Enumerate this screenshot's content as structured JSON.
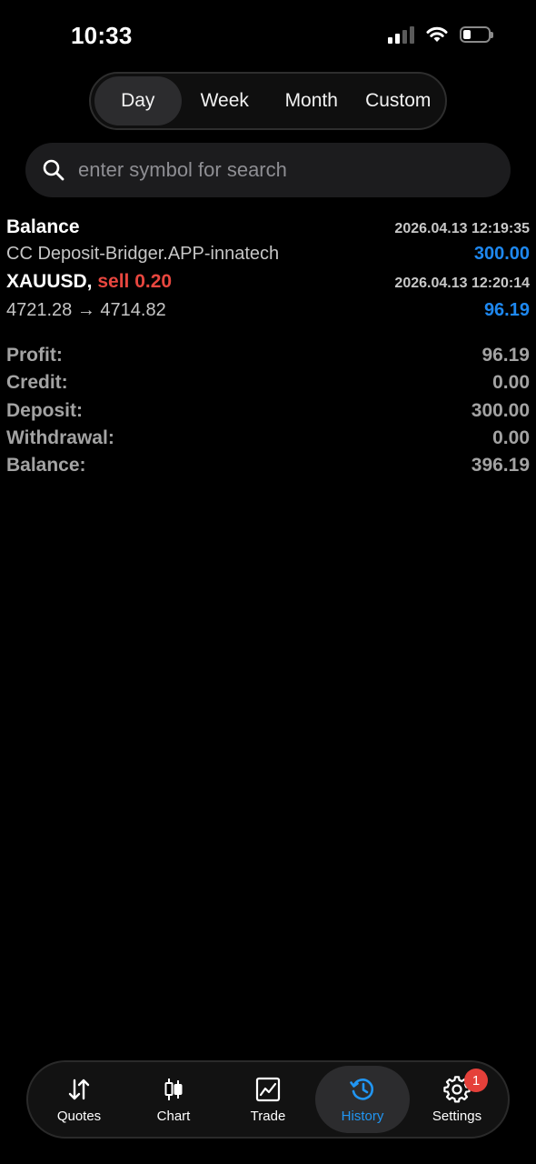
{
  "status_bar": {
    "time": "10:33",
    "icons": [
      "signal-icon",
      "wifi-icon",
      "battery-icon"
    ]
  },
  "period_tabs": [
    {
      "label": "Day",
      "active": true
    },
    {
      "label": "Week",
      "active": false
    },
    {
      "label": "Month",
      "active": false
    },
    {
      "label": "Custom",
      "active": false
    }
  ],
  "search": {
    "placeholder": "enter symbol for search",
    "value": "",
    "icon": "search-icon"
  },
  "history": [
    {
      "title": "Balance",
      "timestamp": "2026.04.13 12:19:35",
      "detail": "CC Deposit-Bridger.APP-innatech",
      "amount": "300.00"
    },
    {
      "symbol": "XAUUSD,",
      "action": "sell 0.20",
      "timestamp": "2026.04.13 12:20:14",
      "detail": "4721.28 → 4714.82",
      "amount": "96.19"
    }
  ],
  "summary": [
    {
      "label": "Profit:",
      "value": "96.19"
    },
    {
      "label": "Credit:",
      "value": "0.00"
    },
    {
      "label": "Deposit:",
      "value": "300.00"
    },
    {
      "label": "Withdrawal:",
      "value": "0.00"
    },
    {
      "label": "Balance:",
      "value": "396.19"
    }
  ],
  "tab_bar": [
    {
      "label": "Quotes",
      "icon": "quotes-arrows-icon",
      "active": false
    },
    {
      "label": "Chart",
      "icon": "candlestick-icon",
      "active": false
    },
    {
      "label": "Trade",
      "icon": "trade-chart-icon",
      "active": false
    },
    {
      "label": "History",
      "icon": "history-clock-icon",
      "active": true
    },
    {
      "label": "Settings",
      "icon": "gear-icon",
      "active": false,
      "badge": "1"
    }
  ],
  "colors": {
    "background": "#000000",
    "accent_blue": "#1e88f0",
    "sell_red": "#e8473f",
    "badge_red": "#e5403a",
    "muted_text": "#a3a3a3"
  }
}
